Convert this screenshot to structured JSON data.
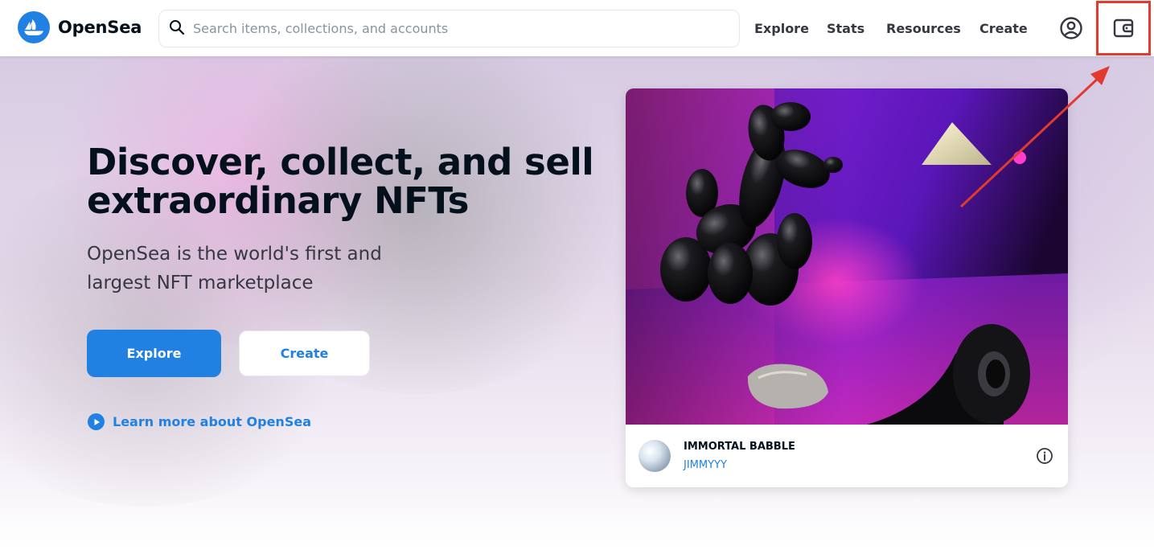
{
  "brand": {
    "name": "OpenSea",
    "accent": "#2081e2"
  },
  "search": {
    "placeholder": "Search items, collections, and accounts",
    "value": ""
  },
  "nav": {
    "items": [
      {
        "label": "Explore"
      },
      {
        "label": "Stats"
      },
      {
        "label": "Resources"
      },
      {
        "label": "Create"
      }
    ],
    "icons": {
      "profile": "account-circle-icon",
      "wallet": "wallet-icon"
    }
  },
  "hero": {
    "title": "Discover, collect, and sell extraordinary NFTs",
    "subtitle": "OpenSea is the world's first and largest NFT marketplace",
    "explore_label": "Explore",
    "create_label": "Create",
    "learn_more": "Learn more about OpenSea"
  },
  "featured": {
    "name": "IMMORTAL BABBLE",
    "creator": "JIMMYYY"
  },
  "annotation": {
    "highlight_color": "#e23a2e",
    "target": "wallet-icon"
  }
}
